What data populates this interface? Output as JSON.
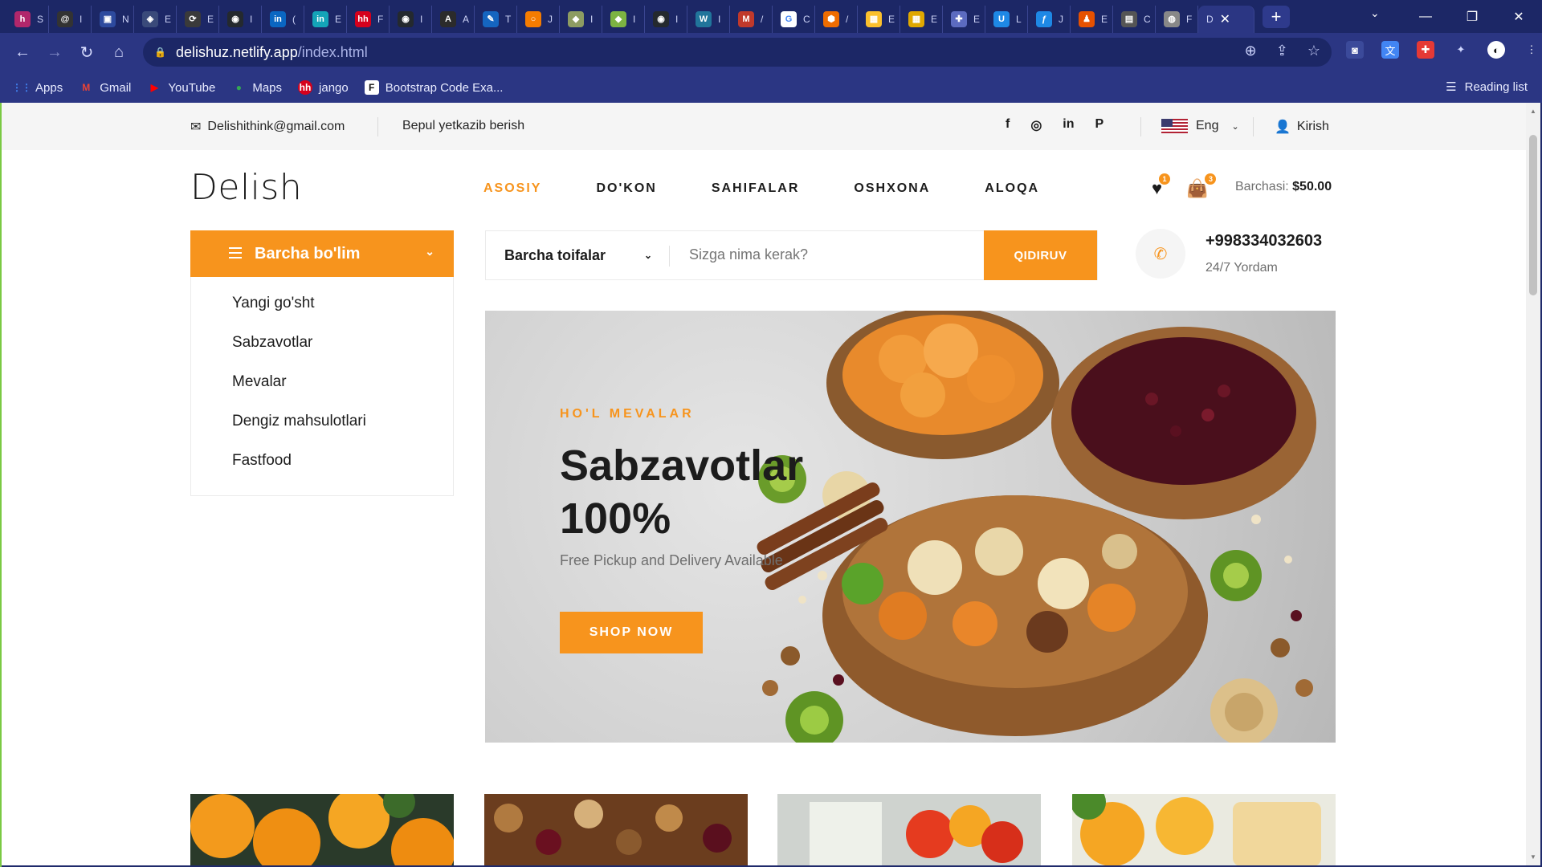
{
  "browser": {
    "tabs": [
      {
        "icon": "h",
        "letter": "S",
        "color": "#b1276b"
      },
      {
        "icon": "@",
        "letter": "I",
        "color": "#333333"
      },
      {
        "icon": "▣",
        "letter": "N",
        "color": "#2d4a9e"
      },
      {
        "icon": "◈",
        "letter": "E",
        "color": "#3a4a7a"
      },
      {
        "icon": "⟳",
        "letter": "E",
        "color": "#3a3a3a"
      },
      {
        "icon": "◉",
        "letter": "I",
        "color": "#24292e"
      },
      {
        "icon": "in",
        "letter": "(",
        "color": "#0a66c2"
      },
      {
        "icon": "in",
        "letter": "E",
        "color": "#14a4b8"
      },
      {
        "icon": "hh",
        "letter": "F",
        "color": "#d6001c"
      },
      {
        "icon": "◉",
        "letter": "I",
        "color": "#24292e"
      },
      {
        "icon": "A",
        "letter": "A",
        "color": "#2b2b2b"
      },
      {
        "icon": "✎",
        "letter": "T",
        "color": "#1565c0"
      },
      {
        "icon": "○",
        "letter": "J",
        "color": "#f57c00"
      },
      {
        "icon": "◆",
        "letter": "I",
        "color": "#8d9c62"
      },
      {
        "icon": "◆",
        "letter": "I",
        "color": "#7cb342"
      },
      {
        "icon": "◉",
        "letter": "I",
        "color": "#24292e"
      },
      {
        "icon": "W",
        "letter": "I",
        "color": "#21759b"
      },
      {
        "icon": "M",
        "letter": "/",
        "color": "#c0392b"
      },
      {
        "icon": "G",
        "letter": "C",
        "color": "#ffffff"
      },
      {
        "icon": "⬢",
        "letter": "/",
        "color": "#ef6c00"
      },
      {
        "icon": "▦",
        "letter": "E",
        "color": "#fbc02d"
      },
      {
        "icon": "▦",
        "letter": "E",
        "color": "#e0a800"
      },
      {
        "icon": "✚",
        "letter": "E",
        "color": "#5c6bc0"
      },
      {
        "icon": "U",
        "letter": "L",
        "color": "#1e88e5"
      },
      {
        "icon": "ƒ",
        "letter": "J",
        "color": "#1e88e5"
      },
      {
        "icon": "♟",
        "letter": "E",
        "color": "#e65100"
      },
      {
        "icon": "▤",
        "letter": "C",
        "color": "#555555"
      },
      {
        "icon": "◍",
        "letter": "F",
        "color": "#888888"
      }
    ],
    "active_tab": {
      "letter": "D"
    },
    "url_domain": "delishuz.netlify.app",
    "url_path": "/index.html",
    "bookmarks": [
      {
        "label": "Apps",
        "icon": "⋮⋮",
        "color": "#4285f4"
      },
      {
        "label": "Gmail",
        "icon": "M",
        "color": "#ea4335"
      },
      {
        "label": "YouTube",
        "icon": "▶",
        "color": "#ff0000"
      },
      {
        "label": "Maps",
        "icon": "●",
        "color": "#34a853"
      },
      {
        "label": "jango",
        "icon": "hh",
        "color": "#d6001c"
      },
      {
        "label": "Bootstrap Code Exa...",
        "icon": "F",
        "color": "#ffffff"
      }
    ],
    "reading_list": "Reading list"
  },
  "topbar": {
    "email": "Delishithink@gmail.com",
    "delivery": "Bepul yetkazib berish",
    "social": [
      "f",
      "◎",
      "in",
      "P"
    ],
    "language": "Eng",
    "login": "Kirish"
  },
  "header": {
    "logo": "Delish",
    "nav": [
      "ASOSIY",
      "DO'KON",
      "SAHIFALAR",
      "OSHXONA",
      "ALOQA"
    ],
    "wishlist_count": "1",
    "cart_count": "3",
    "cart_label": "Barchasi:",
    "cart_total": "$50.00"
  },
  "departments": {
    "title": "Barcha bo'lim",
    "items": [
      "Yangi go'sht",
      "Sabzavotlar",
      "Mevalar",
      "Dengiz mahsulotlari",
      "Fastfood"
    ]
  },
  "search": {
    "category": "Barcha toifalar",
    "placeholder": "Sizga nima kerak?",
    "button": "QIDIRUV"
  },
  "contact": {
    "phone": "+998334032603",
    "help": "24/7 Yordam"
  },
  "hero": {
    "tag": "HO'L MEVALAR",
    "title": "Sabzavotlar 100%",
    "subtitle": "Free Pickup and Delivery Available",
    "button": "SHOP NOW"
  },
  "colors": {
    "accent": "#f7941d",
    "text": "#1c1c1c",
    "muted": "#6f6f6f",
    "browser_dark": "#1c2766",
    "browser": "#2b3683"
  }
}
